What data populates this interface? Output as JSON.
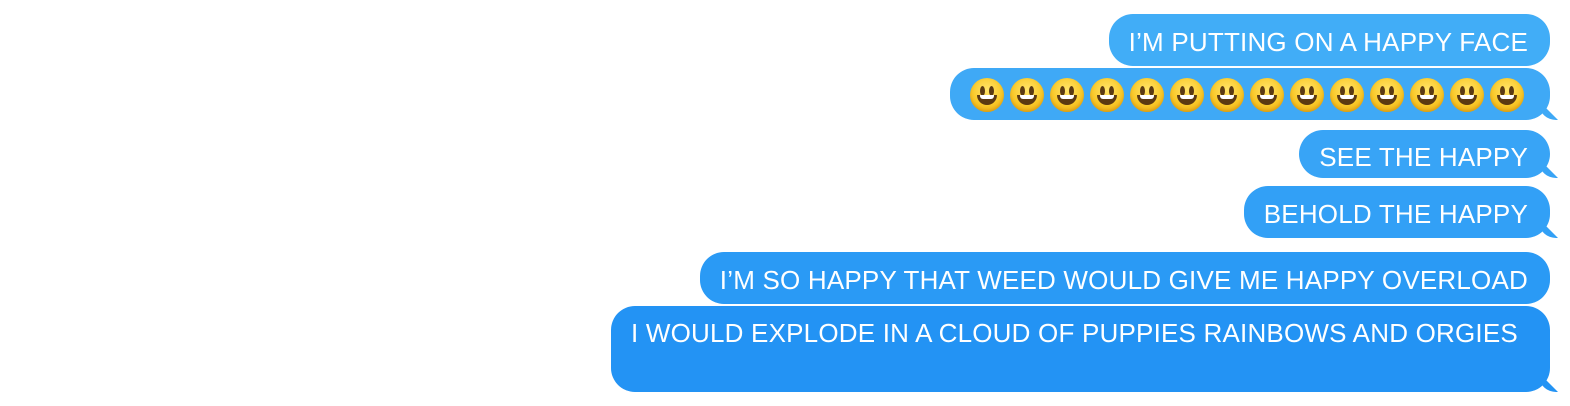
{
  "messages": [
    {
      "text": "I’M PUTTING ON A HAPPY FACE"
    },
    {
      "emoji": "smiley-face",
      "emoji_count": 14
    },
    {
      "text": "SEE THE HAPPY"
    },
    {
      "text": "BEHOLD THE HAPPY"
    },
    {
      "text": "I’M SO HAPPY THAT WEED WOULD GIVE ME HAPPY OVERLOAD"
    },
    {
      "text": "I WOULD EXPLODE IN A CLOUD OF PUPPIES RAINBOWS AND ORGIES"
    }
  ],
  "colors": {
    "bubble_top": "#41adf7",
    "bubble_bottom": "#2393f4",
    "text": "#ffffff",
    "background": "#ffffff"
  }
}
